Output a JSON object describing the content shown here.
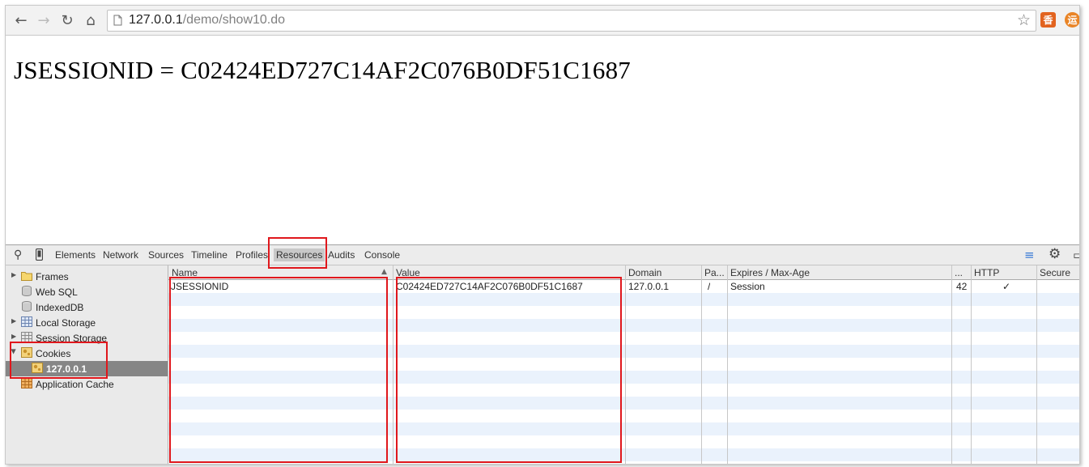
{
  "browser": {
    "url_host": "127.0.0.1",
    "url_path": "/demo/show10.do",
    "extensions": [
      {
        "name": "extension-1",
        "glyph": "香",
        "color": "#e2631f"
      },
      {
        "name": "extension-2",
        "glyph": "运",
        "color": "#e98426"
      }
    ]
  },
  "page": {
    "session_text": "JSESSIONID = C02424ED727C14AF2C076B0DF51C1687"
  },
  "devtools": {
    "tabs": [
      "Elements",
      "Network",
      "Sources",
      "Timeline",
      "Profiles",
      "Resources",
      "Audits",
      "Console"
    ],
    "active_tab": "Resources",
    "sidebar": [
      {
        "label": "Frames",
        "icon": "folder-icon",
        "expandable": true
      },
      {
        "label": "Web SQL",
        "icon": "database-icon",
        "expandable": false
      },
      {
        "label": "IndexedDB",
        "icon": "database-icon",
        "expandable": false
      },
      {
        "label": "Local Storage",
        "icon": "table-icon",
        "expandable": true
      },
      {
        "label": "Session Storage",
        "icon": "table-icon",
        "expandable": true
      },
      {
        "label": "Cookies",
        "icon": "cookie-icon",
        "expanded": true
      },
      {
        "label": "127.0.0.1",
        "icon": "cookie-icon",
        "selected": true
      },
      {
        "label": "Application Cache",
        "icon": "grid-icon",
        "expandable": false
      }
    ],
    "columns": [
      "Name",
      "Value",
      "Domain",
      "Pa...",
      "Expires / Max-Age",
      "...",
      "HTTP",
      "Secure"
    ],
    "cookies": [
      {
        "name": "JSESSIONID",
        "value": "C02424ED727C14AF2C076B0DF51C1687",
        "domain": "127.0.0.1",
        "path": "/",
        "expires": "Session",
        "size": "42",
        "http": "✓",
        "secure": ""
      }
    ]
  },
  "colors": {
    "highlight": "#e0171c",
    "row_stripe": "#eaf2fc",
    "selected_item": "#868686"
  }
}
